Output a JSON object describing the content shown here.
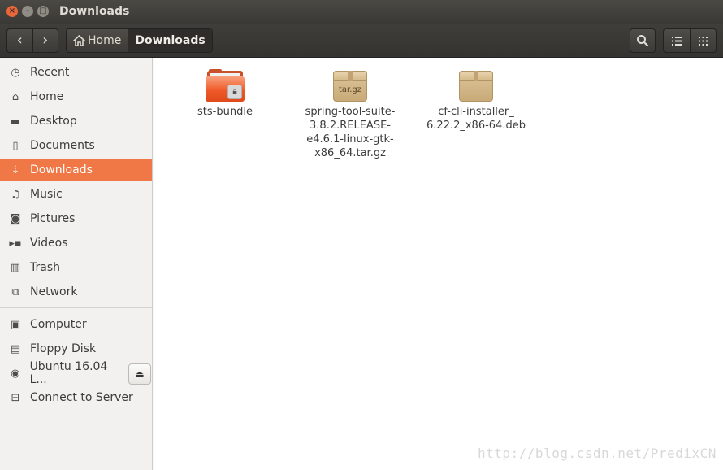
{
  "window": {
    "title": "Downloads"
  },
  "toolbar": {
    "back_glyph": "‹",
    "forward_glyph": "›",
    "breadcrumbs": [
      {
        "label": "Home",
        "icon": "home-icon"
      },
      {
        "label": "Downloads"
      }
    ],
    "search_icon": "search-icon",
    "list_view_icon": "list-view-icon",
    "grid_view_icon": "grid-view-icon"
  },
  "sidebar": {
    "places": [
      {
        "label": "Recent",
        "icon": "clock-icon"
      },
      {
        "label": "Home",
        "icon": "home-icon"
      },
      {
        "label": "Desktop",
        "icon": "folder-icon"
      },
      {
        "label": "Documents",
        "icon": "document-icon"
      },
      {
        "label": "Downloads",
        "icon": "download-icon",
        "selected": true
      },
      {
        "label": "Music",
        "icon": "music-icon"
      },
      {
        "label": "Pictures",
        "icon": "camera-icon"
      },
      {
        "label": "Videos",
        "icon": "video-icon"
      },
      {
        "label": "Trash",
        "icon": "trash-icon"
      },
      {
        "label": "Network",
        "icon": "network-icon"
      }
    ],
    "devices": [
      {
        "label": "Computer",
        "icon": "computer-icon"
      },
      {
        "label": "Floppy Disk",
        "icon": "floppy-icon"
      },
      {
        "label": "Ubuntu 16.04 L...",
        "icon": "disc-icon"
      },
      {
        "label": "Connect to Server",
        "icon": "server-icon"
      }
    ]
  },
  "files": [
    {
      "name_lines": [
        "sts-bundle"
      ],
      "type": "folder-locked"
    },
    {
      "name_lines": [
        "spring-tool-suite-",
        "3.8.2.RELEASE-",
        "e4.6.1-linux-gtk-",
        "x86_64.tar.gz"
      ],
      "type": "archive",
      "badge": "tar.gz"
    },
    {
      "name_lines": [
        "cf-cli-installer_",
        "6.22.2_x86-64.deb"
      ],
      "type": "package",
      "badge": ""
    }
  ],
  "watermark": "http://blog.csdn.net/PredixCN",
  "colors": {
    "accent": "#f07746",
    "titlebar": "#3c3b37"
  }
}
